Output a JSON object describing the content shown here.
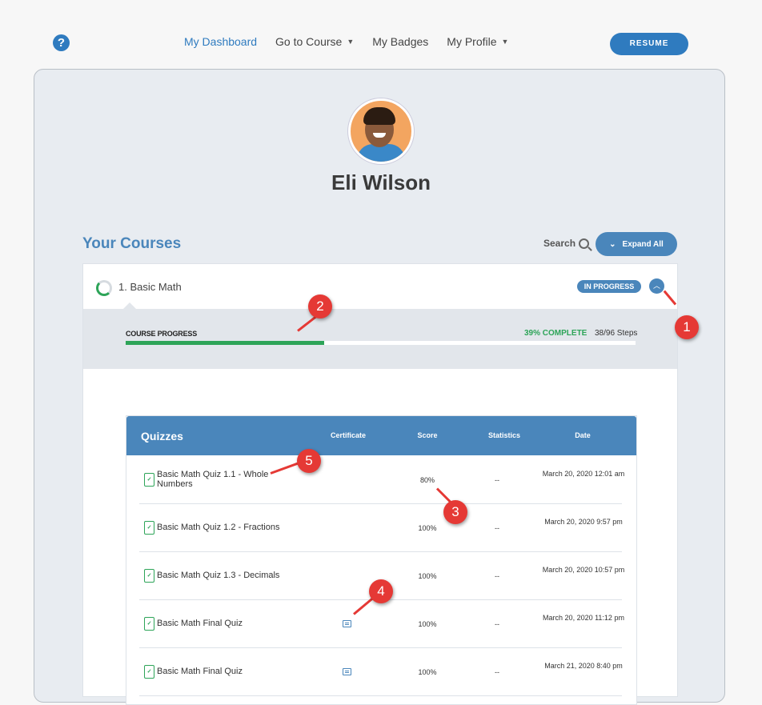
{
  "nav": {
    "items": [
      {
        "label": "My Dashboard",
        "active": true,
        "dropdown": false
      },
      {
        "label": "Go to Course",
        "active": false,
        "dropdown": true
      },
      {
        "label": "My Badges",
        "active": false,
        "dropdown": false
      },
      {
        "label": "My Profile",
        "active": false,
        "dropdown": true
      }
    ],
    "resume_label": "RESUME",
    "help_glyph": "?"
  },
  "profile": {
    "name": "Eli Wilson"
  },
  "courses": {
    "title": "Your Courses",
    "search_label": "Search",
    "expand_label": "Expand All"
  },
  "course": {
    "name": "1. Basic Math",
    "status": "IN PROGRESS",
    "progress_label": "COURSE PROGRESS",
    "progress_pct_text": "39% COMPLETE",
    "progress_fraction": 0.39,
    "steps_text": "38/96 Steps"
  },
  "quizzes": {
    "title": "Quizzes",
    "columns": {
      "certificate": "Certificate",
      "score": "Score",
      "statistics": "Statistics",
      "date": "Date"
    },
    "rows": [
      {
        "name": "Basic Math Quiz 1.1 - Whole Numbers",
        "certificate": false,
        "score": "80%",
        "stats": "--",
        "date": "March 20, 2020 12:01 am"
      },
      {
        "name": "Basic Math Quiz 1.2 - Fractions",
        "certificate": false,
        "score": "100%",
        "stats": "--",
        "date": "March 20, 2020 9:57 pm"
      },
      {
        "name": "Basic Math Quiz 1.3 - Decimals",
        "certificate": false,
        "score": "100%",
        "stats": "--",
        "date": "March 20, 2020 10:57 pm"
      },
      {
        "name": "Basic Math Final Quiz",
        "certificate": true,
        "score": "100%",
        "stats": "--",
        "date": "March 20, 2020 11:12 pm"
      },
      {
        "name": "Basic Math Final Quiz",
        "certificate": true,
        "score": "100%",
        "stats": "--",
        "date": "March 21, 2020 8:40 pm"
      }
    ]
  },
  "callouts": [
    "1",
    "2",
    "3",
    "4",
    "5"
  ],
  "colors": {
    "accent": "#4a86bb",
    "success": "#2da458",
    "callout": "#e53935"
  }
}
